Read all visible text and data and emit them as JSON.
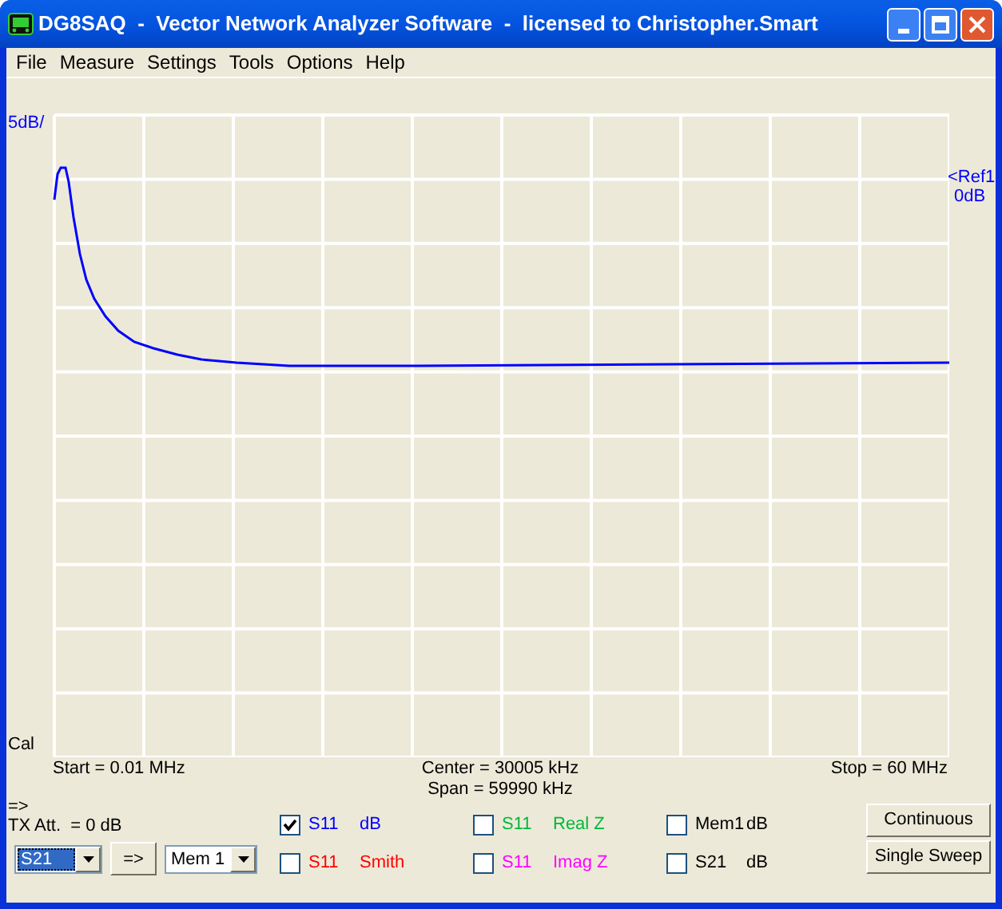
{
  "window": {
    "title": "DG8SAQ  -  Vector Network Analyzer Software  -  licensed to Christopher.Smart"
  },
  "menu": [
    "File",
    "Measure",
    "Settings",
    "Tools",
    "Options",
    "Help"
  ],
  "plot": {
    "scale_label": "5dB/",
    "cal_label": "Cal",
    "ref_label": "<Ref1",
    "ref_value": "0dB",
    "start": "Start = 0.01 MHz",
    "center": "Center = 30005 kHz",
    "span": "Span = 59990 kHz",
    "stop": "Stop = 60 MHz"
  },
  "transfer": {
    "arrow_label": "=>",
    "tx_att": "TX Att.  = 0 dB",
    "source": "S21",
    "copy_button": "=>",
    "target": "Mem 1"
  },
  "traces": [
    {
      "checked": true,
      "param": "S11",
      "format": "dB",
      "color": "#0000ff"
    },
    {
      "checked": false,
      "param": "S11",
      "format": "Smith",
      "color": "#ff0000"
    },
    {
      "checked": false,
      "param": "S11",
      "format": "Real Z",
      "color": "#00b838"
    },
    {
      "checked": false,
      "param": "S11",
      "format": "Imag Z",
      "color": "#ff00ff"
    },
    {
      "checked": false,
      "param": "Mem1",
      "format": "dB",
      "color": "#000000"
    },
    {
      "checked": false,
      "param": "S21",
      "format": "dB",
      "color": "#000000"
    }
  ],
  "buttons": [
    "Continuous",
    "Single Sweep"
  ]
}
